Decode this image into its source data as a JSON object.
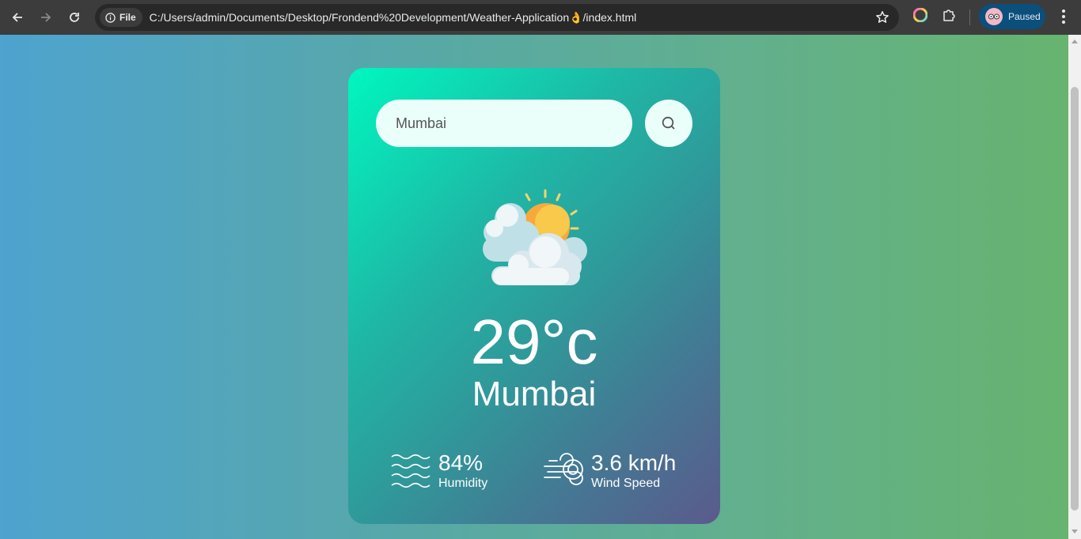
{
  "browser": {
    "chip_label": "File",
    "url": "C:/Users/admin/Documents/Desktop/Frondend%20Development/Weather-Application👌/index.html",
    "profile_label": "Paused"
  },
  "weather": {
    "search_value": "Mumbai",
    "temperature": "29°c",
    "city": "Mumbai",
    "humidity_value": "84%",
    "humidity_label": "Humidity",
    "wind_value": "3.6 km/h",
    "wind_label": "Wind Speed",
    "icon": "sun-behind-clouds-icon"
  }
}
